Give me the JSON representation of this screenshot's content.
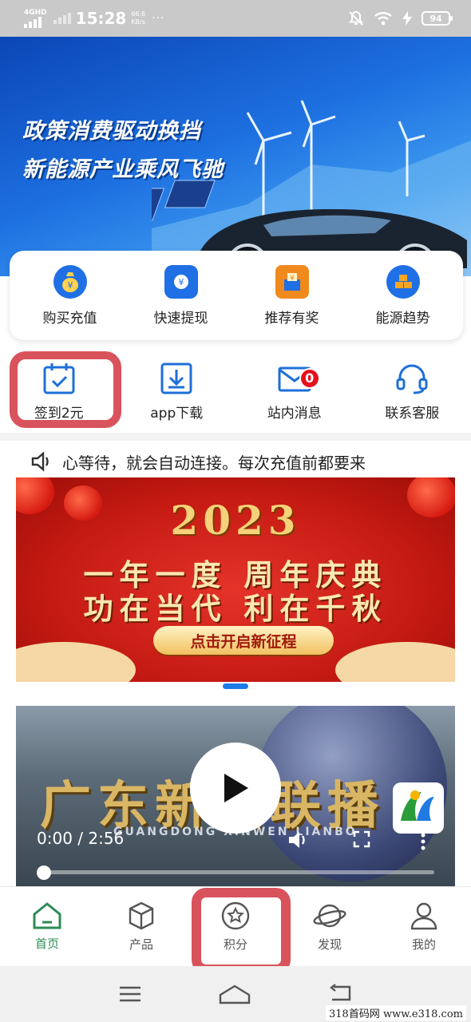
{
  "status_bar": {
    "network": "4GHD",
    "time": "15:28",
    "speed_value": "66.6",
    "speed_unit": "KB/s",
    "more": "···",
    "battery": "94"
  },
  "hero": {
    "line1": "政策消费驱动换挡",
    "line2": "新能源产业乘风飞驰"
  },
  "quick_menu": [
    {
      "label": "购买充值",
      "icon": "money-bag-icon",
      "color": "#1f6fe5"
    },
    {
      "label": "快速提现",
      "icon": "wallet-icon",
      "color": "#1f6fe5"
    },
    {
      "label": "推荐有奖",
      "icon": "gift-box-icon",
      "color": "#f08a1c"
    },
    {
      "label": "能源趋势",
      "icon": "bars-icon",
      "color": "#1f6fe5"
    }
  ],
  "actions": [
    {
      "label": "签到2元",
      "icon": "calendar-check-icon"
    },
    {
      "label": "app下载",
      "icon": "download-icon"
    },
    {
      "label": "站内消息",
      "icon": "mail-icon",
      "badge": "0"
    },
    {
      "label": "联系客服",
      "icon": "headset-icon"
    }
  ],
  "notice": {
    "text": "心等待，就会自动连接。每次充值前都要来"
  },
  "promo": {
    "year": "2023",
    "line1": "一年一度 周年庆典",
    "line2": "功在当代 利在千秋",
    "cta": "点击开启新征程"
  },
  "video": {
    "title": "广东新闻联播",
    "subtitle": "GUANGDONG XINWEN LIANBO",
    "time": "0:00 / 2:56",
    "progress": 0
  },
  "tabbar": [
    {
      "label": "首页",
      "icon": "home-icon",
      "active": true
    },
    {
      "label": "产品",
      "icon": "cube-icon",
      "active": false
    },
    {
      "label": "积分",
      "icon": "star-circle-icon",
      "active": false
    },
    {
      "label": "发现",
      "icon": "planet-icon",
      "active": false
    },
    {
      "label": "我的",
      "icon": "user-icon",
      "active": false
    }
  ],
  "watermark": "318首码网 www.e318.com",
  "colors": {
    "accent_green": "#2e8b57",
    "highlight_red": "#d9535c",
    "brand_blue": "#1f6fe5",
    "badge_red": "#e5101d"
  }
}
